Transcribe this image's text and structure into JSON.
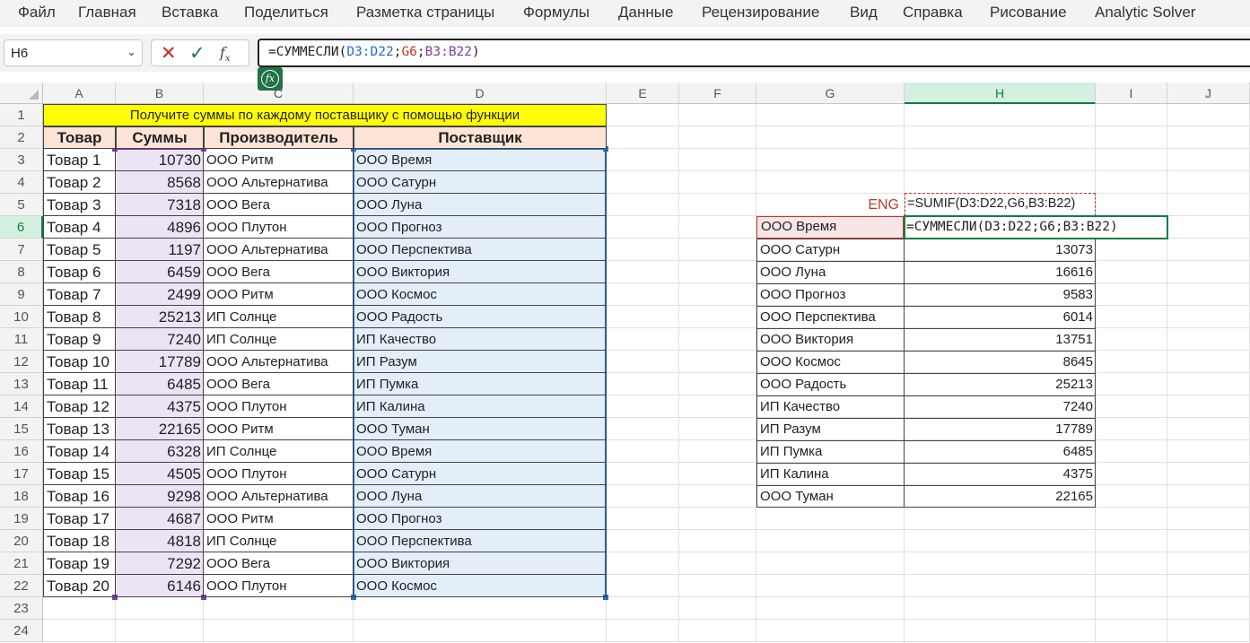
{
  "menu": [
    "Файл",
    "Главная",
    "Вставка",
    "Поделиться",
    "Разметка страницы",
    "Формулы",
    "Данные",
    "Рецензирование",
    "Вид",
    "Справка",
    "Рисование",
    "Analytic Solver"
  ],
  "namebox": "H6",
  "formula_parts": {
    "start": "=СУММЕСЛИ(",
    "arg1": "D3:D22",
    "sep1": ";",
    "arg2": "G6",
    "sep2": ";",
    "arg3": "B3:B22",
    "end": ")"
  },
  "columns": [
    "A",
    "B",
    "C",
    "D",
    "E",
    "F",
    "G",
    "H",
    "I",
    "J"
  ],
  "rows": [
    "1",
    "2",
    "3",
    "4",
    "5",
    "6",
    "7",
    "8",
    "9",
    "10",
    "11",
    "12",
    "13",
    "14",
    "15",
    "16",
    "17",
    "18",
    "19",
    "20",
    "21",
    "22",
    "23",
    "24"
  ],
  "title": "Получите суммы по каждому поставщику с помощью функции",
  "headers": [
    "Товар",
    "Суммы",
    "Производитель",
    "Поставщик"
  ],
  "table": [
    [
      "Товар 1",
      "10730",
      "ООО Ритм",
      "ООО Время"
    ],
    [
      "Товар 2",
      "8568",
      "ООО Альтернатива",
      "ООО Сатурн"
    ],
    [
      "Товар 3",
      "7318",
      "ООО Вега",
      "ООО Луна"
    ],
    [
      "Товар 4",
      "4896",
      "ООО Плутон",
      "ООО Прогноз"
    ],
    [
      "Товар 5",
      "1197",
      "ООО Альтернатива",
      "ООО Перспектива"
    ],
    [
      "Товар 6",
      "6459",
      "ООО Вега",
      "ООО Виктория"
    ],
    [
      "Товар 7",
      "2499",
      "ООО Ритм",
      "ООО Космос"
    ],
    [
      "Товар 8",
      "25213",
      "ИП Солнце",
      "ООО Радость"
    ],
    [
      "Товар 9",
      "7240",
      "ИП Солнце",
      "ИП Качество"
    ],
    [
      "Товар 10",
      "17789",
      "ООО Альтернатива",
      "ИП Разум"
    ],
    [
      "Товар 11",
      "6485",
      "ООО Вега",
      "ИП Пумка"
    ],
    [
      "Товар 12",
      "4375",
      "ООО Плутон",
      "ИП Калина"
    ],
    [
      "Товар 13",
      "22165",
      "ООО Ритм",
      "ООО Туман"
    ],
    [
      "Товар 14",
      "6328",
      "ИП Солнце",
      "ООО Время"
    ],
    [
      "Товар 15",
      "4505",
      "ООО Плутон",
      "ООО Сатурн"
    ],
    [
      "Товар 16",
      "9298",
      "ООО Альтернатива",
      "ООО Луна"
    ],
    [
      "Товар 17",
      "4687",
      "ООО Ритм",
      "ООО Прогноз"
    ],
    [
      "Товар 18",
      "4818",
      "ИП Солнце",
      "ООО Перспектива"
    ],
    [
      "Товар 19",
      "7292",
      "ООО Вега",
      "ООО Виктория"
    ],
    [
      "Товар 20",
      "6146",
      "ООО Плутон",
      "ООО Космос"
    ]
  ],
  "eng_label": "ENG",
  "eng_formula": "=SUMIF(D3:D22,G6,B3:B22)",
  "g6": "ООО Время",
  "h6": "=СУММЕСЛИ(D3:D22;G6;B3:B22)",
  "summary": [
    [
      "ООО Сатурн",
      "13073"
    ],
    [
      "ООО Луна",
      "16616"
    ],
    [
      "ООО Прогноз",
      "9583"
    ],
    [
      "ООО Перспектива",
      "6014"
    ],
    [
      "ООО Виктория",
      "13751"
    ],
    [
      "ООО Космос",
      "8645"
    ],
    [
      "ООО Радость",
      "25213"
    ],
    [
      "ИП Качество",
      "7240"
    ],
    [
      "ИП Разум",
      "17789"
    ],
    [
      "ИП Пумка",
      "6485"
    ],
    [
      "ИП Калина",
      "4375"
    ],
    [
      "ООО Туман",
      "22165"
    ]
  ],
  "colors": {
    "title_fill": "#ffff00",
    "header_fill": "#fce4d6",
    "accent_green": "#107c41",
    "range_blue": "#1e6fcf",
    "range_purple": "#7b3fa6",
    "criteria_red": "#c0392b"
  }
}
